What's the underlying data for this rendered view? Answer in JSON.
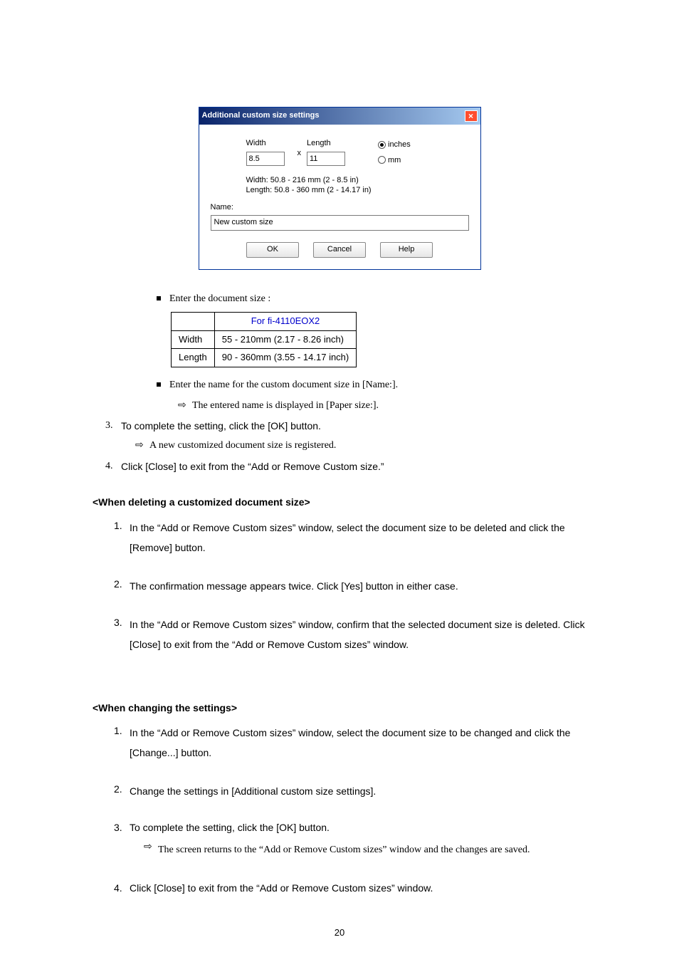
{
  "dialog": {
    "title": "Additional custom size settings",
    "width_label": "Width",
    "length_label": "Length",
    "width_value": "8.5",
    "length_value": "11",
    "x_sep": "x",
    "unit_inches": "inches",
    "unit_mm": "mm",
    "range_width": "Width: 50.8 - 216 mm  (2 - 8.5 in)",
    "range_length": "Length: 50.8 - 360 mm  (2 - 14.17 in)",
    "name_label": "Name:",
    "name_value": "New custom size",
    "btn_ok": "OK",
    "btn_cancel": "Cancel",
    "btn_help": "Help",
    "close_x": "×"
  },
  "bullets": {
    "enter_size": "Enter the document size :",
    "enter_name": "Enter the name for the custom document size in [Name:].",
    "name_result": "The entered name is displayed in [Paper size:]."
  },
  "size_table": {
    "header": "For fi-4110EOX2",
    "rows": [
      {
        "label": "Width",
        "value": "55 - 210mm (2.17 - 8.26 inch)"
      },
      {
        "label": "Length",
        "value": "90 - 360mm (3.55 - 14.17 inch)"
      }
    ]
  },
  "steps_a": {
    "s3": "To complete the setting, click the [OK] button.",
    "s3_result": "A new customized document size is registered.",
    "s4": "Click [Close] to exit from the “Add or Remove Custom size.”"
  },
  "section_delete": {
    "title": "<When deleting a customized document size>",
    "s1": "In the “Add or Remove Custom sizes” window, select the document size to be deleted and click the [Remove] button.",
    "s2": "The confirmation message appears twice. Click [Yes] button in either case.",
    "s3": "In the “Add or Remove Custom sizes” window, confirm that the selected document size is deleted. Click [Close] to exit from the “Add or Remove Custom sizes” window."
  },
  "section_change": {
    "title": "<When changing the settings>",
    "s1": "In the “Add or Remove Custom sizes” window, select the document size to be changed and click the [Change...] button.",
    "s2": "Change the settings in [Additional custom size settings].",
    "s3": "To complete the setting, click the [OK] button.",
    "s3_result": "The screen returns to the “Add or Remove Custom sizes” window and the changes are saved.",
    "s4": "Click [Close] to exit from the “Add or Remove Custom sizes” window."
  },
  "page_number": "20",
  "nums": {
    "n1": "1.",
    "n2": "2.",
    "n3": "3.",
    "n4": "4."
  },
  "arrow": "⇨"
}
